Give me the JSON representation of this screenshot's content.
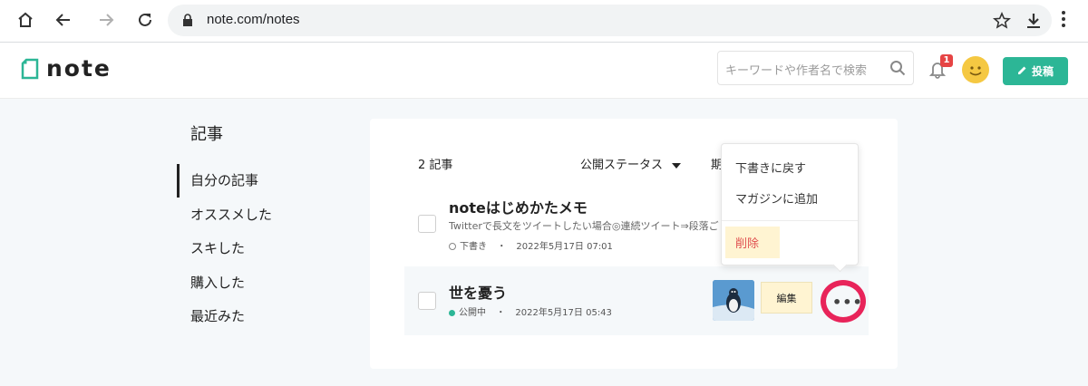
{
  "browser": {
    "url": "note.com/notes"
  },
  "header": {
    "logo_text": "note",
    "search_placeholder": "キーワードや作者名で検索",
    "notification_count": "1",
    "post_label": "投稿"
  },
  "sidebar": {
    "title": "記事",
    "items": [
      {
        "label": "自分の記事"
      },
      {
        "label": "オススメした"
      },
      {
        "label": "スキした"
      },
      {
        "label": "購入した"
      },
      {
        "label": "最近みた"
      }
    ]
  },
  "main": {
    "count_label": "2 記事",
    "status_filter_label": "公開ステータス",
    "period_filter_label": "期",
    "articles": [
      {
        "title": "noteはじめかたメモ",
        "excerpt": "Twitterで長文をツイートしたい場合◎連続ツイート⇒段落ご",
        "status": "下書き",
        "separator": "・",
        "date": "2022年5月17日 07:01"
      },
      {
        "title": "世を憂う",
        "status": "公開中",
        "separator": "・",
        "date": "2022年5月17日 05:43",
        "edit_label": "編集",
        "more_label": "•••"
      }
    ]
  },
  "popup_menu": {
    "items": [
      {
        "label": "下書きに戻す"
      },
      {
        "label": "マガジンに追加"
      },
      {
        "label": "削除"
      }
    ]
  },
  "colors": {
    "brand_green": "#2cb696",
    "badge_red": "#e64444",
    "delete_red": "#e05050",
    "highlight_yellow": "#fff4d2",
    "annotation_circle": "#e8245a"
  }
}
